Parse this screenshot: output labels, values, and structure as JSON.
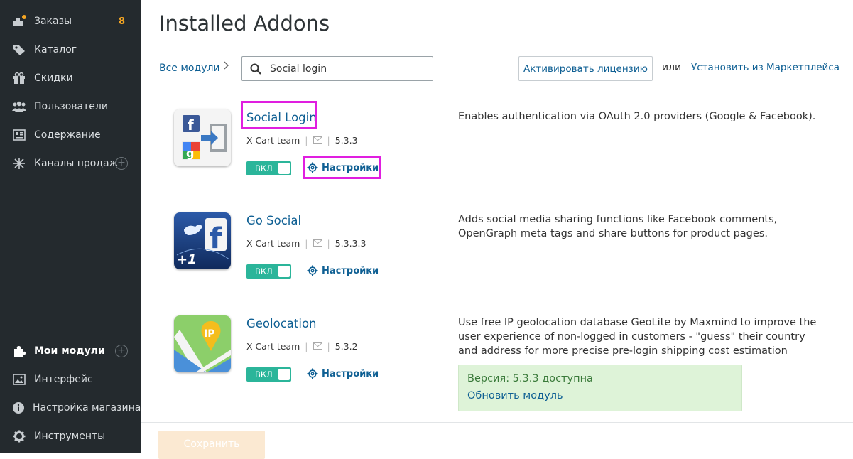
{
  "sidebar": {
    "items": [
      {
        "label": "Заказы",
        "icon": "orders-icon",
        "badge": "8"
      },
      {
        "label": "Каталог",
        "icon": "tag-icon"
      },
      {
        "label": "Скидки",
        "icon": "gift-icon"
      },
      {
        "label": "Пользователи",
        "icon": "users-icon"
      },
      {
        "label": "Содержание",
        "icon": "content-icon"
      },
      {
        "label": "Каналы продаж",
        "icon": "sales-channels-icon"
      },
      {
        "label": "Мои модули",
        "icon": "puzzle-icon"
      },
      {
        "label": "Интерфейс",
        "icon": "image-icon"
      },
      {
        "label": "Настройка магазина",
        "icon": "info-icon"
      },
      {
        "label": "Инструменты",
        "icon": "gear-icon"
      }
    ]
  },
  "header": {
    "title": "Installed Addons",
    "breadcrumb": "Все модули",
    "search_value": "Social login",
    "license_button": "Активировать лицензию",
    "or_text": "или",
    "marketplace_link": "Установить из Маркетплейса"
  },
  "addons": [
    {
      "name": "Social Login",
      "author": "X-Cart team",
      "version": "5.3.3",
      "toggle": "ВКЛ",
      "settings": "Настройки",
      "description": "Enables authentication via OAuth 2.0 providers (Google & Facebook)."
    },
    {
      "name": "Go Social",
      "author": "X-Cart team",
      "version": "5.3.3.3",
      "toggle": "ВКЛ",
      "settings": "Настройки",
      "description": "Adds social media sharing functions like Facebook comments, OpenGraph meta tags and share buttons for product pages."
    },
    {
      "name": "Geolocation",
      "author": "X-Cart team",
      "version": "5.3.2",
      "toggle": "ВКЛ",
      "settings": "Настройки",
      "description": "Use free IP geolocation database GeoLite by Maxmind to improve the user experience of non-logged in customers - \"guess\" their country and address for more precise pre-login shipping cost estimation",
      "update": {
        "version_text": "Версия: 5.3.3 доступна",
        "link": "Обновить модуль"
      }
    }
  ],
  "footer": {
    "save_button": "Сохранить"
  },
  "colors": {
    "sidebar_bg": "#242a2e",
    "accent": "#0e5f93",
    "toggle_on": "#2bb59a",
    "highlight": "#e01ee0",
    "badge": "#f5a623"
  }
}
